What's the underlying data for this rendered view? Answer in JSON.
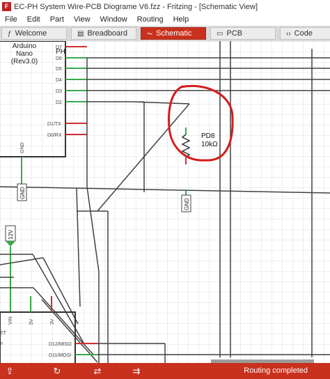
{
  "window": {
    "title": "EC-PH System Wire-PCB Diograme V6.fzz - Fritzing - [Schematic View]"
  },
  "menu": [
    "File",
    "Edit",
    "Part",
    "View",
    "Window",
    "Routing",
    "Help"
  ],
  "tabs": [
    {
      "label": "Welcome",
      "icon": "welcome-icon",
      "active": false
    },
    {
      "label": "Breadboard",
      "icon": "breadboard-icon",
      "active": false
    },
    {
      "label": "Schematic",
      "icon": "schematic-icon",
      "active": true
    },
    {
      "label": "PCB",
      "icon": "pcb-icon",
      "active": false
    },
    {
      "label": "Code",
      "icon": "code-icon",
      "active": false
    }
  ],
  "schematic": {
    "arduino": {
      "line1": "Arduino",
      "line2": "Nano",
      "line3": "(Rev3.0)",
      "ph_label": "PH",
      "pins": [
        "D7",
        "D6",
        "D5",
        "D4",
        "D3",
        "D2",
        "D1/TX",
        "D0/RX"
      ],
      "gnd_pin": "GND"
    },
    "resistor": {
      "name": "PD8",
      "value": "10kΩ"
    },
    "gnd_symbol_left": "GND",
    "gnd_symbol_right": "GND",
    "supply_12v": "12V",
    "lower_pins": [
      "VIN",
      "5V",
      "3V"
    ],
    "lower_right_pins": [
      "D12/MISO",
      "D11/MOSI"
    ],
    "cut_labels": [
      "ET",
      "F"
    ]
  },
  "colors": {
    "accent": "#c8311e",
    "wire": "#404040",
    "pin_red": "#d03030",
    "pin_green": "#3aa84a",
    "annotation": "#d41c1c"
  },
  "status": {
    "text": "Routing completed"
  },
  "toolbar_icons": [
    "share-icon",
    "rotate-icon",
    "flip-icon",
    "autoroute-icon"
  ]
}
